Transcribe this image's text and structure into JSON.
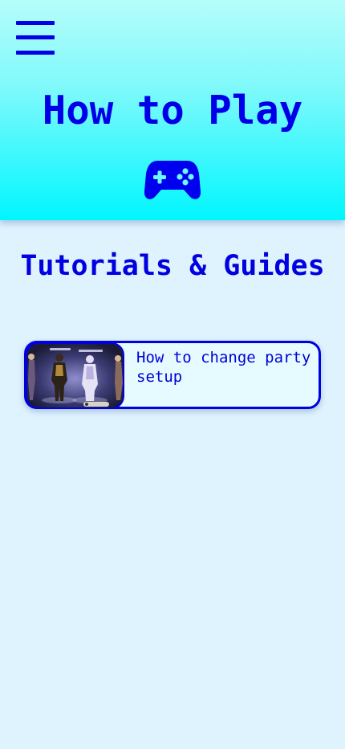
{
  "header": {
    "title": "How to Play",
    "menu_icon": "hamburger-menu-icon",
    "title_icon": "gamepad-icon"
  },
  "main": {
    "section_title": "Tutorials & Guides",
    "tutorials": [
      {
        "title": "How to change party setup",
        "thumbnail": "party-setup-screenshot"
      }
    ]
  },
  "colors": {
    "accent": "#0000e0",
    "header_gradient_top": "#b5fdfa",
    "header_gradient_bottom": "#00f6ff",
    "page_background": "#dff3ff",
    "card_background": "#e6fbff"
  }
}
